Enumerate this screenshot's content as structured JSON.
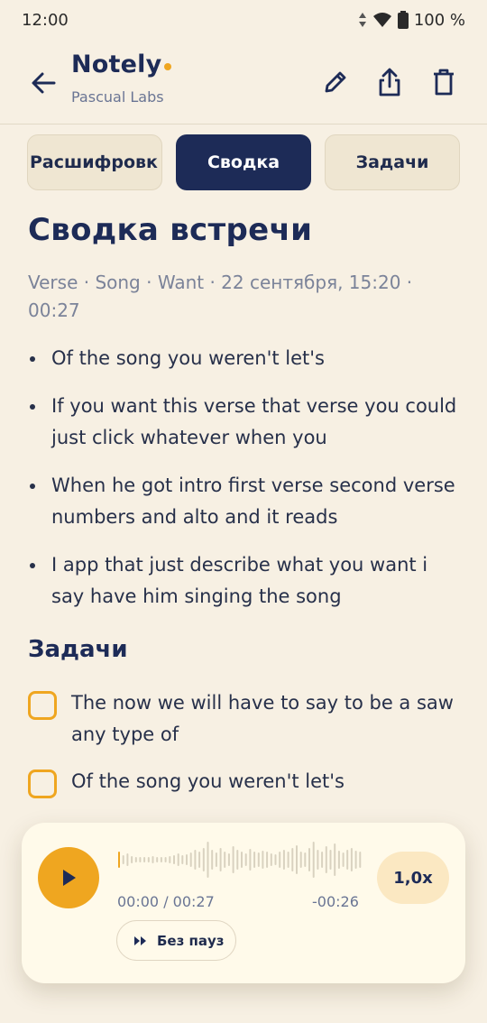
{
  "status": {
    "time": "12:00",
    "battery": "100 %"
  },
  "header": {
    "app_name": "Notely",
    "subtitle": "Pascual Labs"
  },
  "tabs": [
    {
      "label": "Расшифровк",
      "active": false
    },
    {
      "label": "Сводка",
      "active": true
    },
    {
      "label": "Задачи",
      "active": false
    }
  ],
  "summary": {
    "title": "Сводка встречи",
    "meta": "Verse · Song · Want · 22 сентября, 15:20 · 00:27",
    "bullets": [
      "Of the song you weren't let's",
      "If you want this verse that verse you could just click whatever when you",
      "When he got intro first verse second verse numbers and alto and it reads",
      "I app that just describe what you want i say have him singing the song"
    ]
  },
  "tasks": {
    "title": "Задачи",
    "items": [
      {
        "text": "The now we will have to say to be a saw any type of",
        "done": false
      },
      {
        "text": "Of the song you weren't let's",
        "done": false
      }
    ]
  },
  "player": {
    "time": "00:00 / 00:27",
    "remaining": "-00:26",
    "speed": "1,0x",
    "skip_label": "Без пауз",
    "progress": 0.0
  },
  "colors": {
    "accent": "#efa620",
    "primary": "#1d2b57",
    "background": "#f7f0e3"
  },
  "icons": [
    "arrow-back-icon",
    "edit-icon",
    "share-icon",
    "delete-icon",
    "play-icon",
    "skip-silence-icon"
  ]
}
